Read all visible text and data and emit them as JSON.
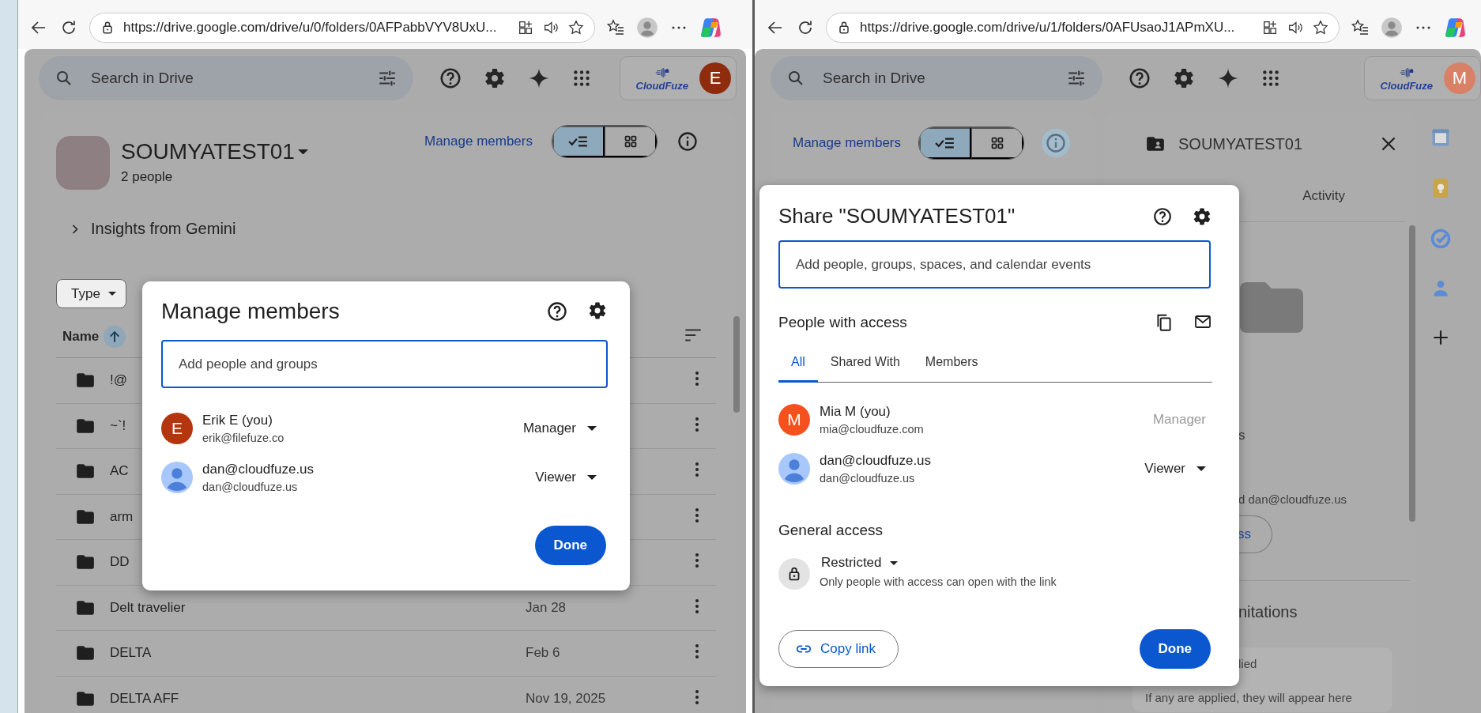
{
  "left_window": {
    "browser": {
      "url": "https://drive.google.com/drive/u/0/folders/0AFPabbVYV8UxU..."
    },
    "drive_header": {
      "search_placeholder": "Search in Drive",
      "brand": "CloudFuze",
      "avatar_letter": "E"
    },
    "folder": {
      "name": "SOUMYATEST01",
      "member_count": "2 people",
      "manage_link": "Manage members",
      "insights": "Insights from Gemini"
    },
    "view_toggle": [
      {
        "kind": "list",
        "selected": true
      },
      {
        "kind": "grid",
        "selected": false
      }
    ],
    "filters": [
      {
        "label": "Type"
      }
    ],
    "table": {
      "columns": [
        {
          "label": "Name",
          "sorted": true
        }
      ],
      "rows": [
        {
          "name": "!@"
        },
        {
          "name": "~`!"
        },
        {
          "name": "AC"
        },
        {
          "name": "arm"
        },
        {
          "name": "DD"
        },
        {
          "name": "Delt travelier",
          "modified": "Jan 28"
        },
        {
          "name": "DELTA",
          "modified": "Feb 6"
        },
        {
          "name": "DELTA AFF",
          "modified": "Nov 19, 2025"
        }
      ]
    },
    "dialog": {
      "title": "Manage members",
      "input_placeholder": "Add people and groups",
      "members": [
        {
          "name": "Erik E (you)",
          "email": "erik@filefuze.co",
          "role": "Manager",
          "role_locked": false,
          "avatar": {
            "kind": "letter",
            "letter": "E",
            "color": "#b5360e"
          }
        },
        {
          "name": "dan@cloudfuze.us",
          "email": "dan@cloudfuze.us",
          "role": "Viewer",
          "role_locked": false,
          "avatar": {
            "kind": "silhouette"
          }
        }
      ],
      "done": "Done"
    }
  },
  "right_window": {
    "browser": {
      "url": "https://drive.google.com/drive/u/1/folders/0AFUsaoJ1APmXU..."
    },
    "drive_header": {
      "search_placeholder": "Search in Drive",
      "brand": "CloudFuze",
      "avatar_letter": "M"
    },
    "toolbar": {
      "manage_link": "Manage members",
      "details_open": true
    },
    "view_toggle": [
      {
        "kind": "list",
        "selected": true
      },
      {
        "kind": "grid",
        "selected": false
      }
    ],
    "details_panel": {
      "title": "SOUMYATEST01",
      "tab": "Activity",
      "fragment_1": "s",
      "fragment_2": "d dan@cloudfuze.us",
      "button_fragment": "ss",
      "heading_fragment": "nitations",
      "note_fragment": "lied",
      "note": "If any are applied, they will appear here"
    },
    "dialog": {
      "title": "Share \"SOUMYATEST01\"",
      "input_placeholder": "Add people, groups, spaces, and calendar events",
      "section": "People with access",
      "tabs": [
        {
          "label": "All",
          "selected": true
        },
        {
          "label": "Shared With",
          "selected": false
        },
        {
          "label": "Members",
          "selected": false
        }
      ],
      "members": [
        {
          "name": "Mia M (you)",
          "email": "mia@cloudfuze.com",
          "role": "Manager",
          "role_locked": true,
          "avatar": {
            "kind": "letter",
            "letter": "M",
            "color": "#f4511e"
          }
        },
        {
          "name": "dan@cloudfuze.us",
          "email": "dan@cloudfuze.us",
          "role": "Viewer",
          "role_locked": false,
          "avatar": {
            "kind": "silhouette"
          }
        }
      ],
      "general_access": {
        "heading": "General access",
        "level": "Restricted",
        "description": "Only people with access can open with the link"
      },
      "copy_link": "Copy link",
      "done": "Done"
    }
  }
}
